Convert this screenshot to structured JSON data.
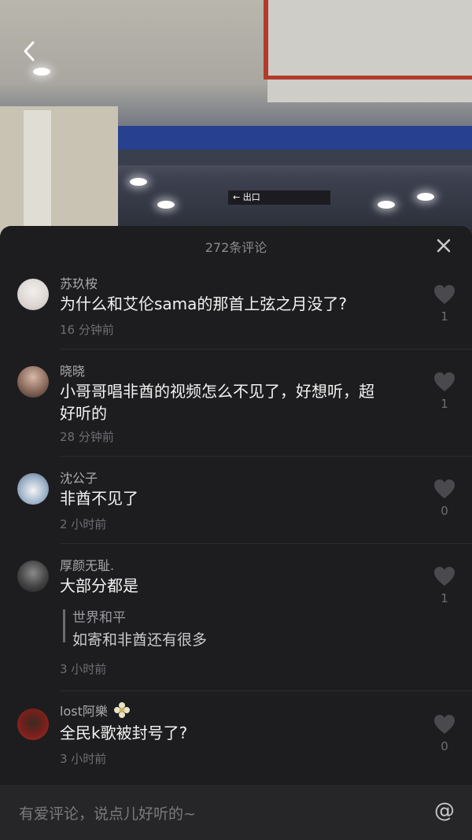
{
  "header": {
    "comment_count_title": "272条评论"
  },
  "video": {
    "exit_sign_text": "出口"
  },
  "comments": [
    {
      "user": "苏玖桉",
      "text": "为什么和艾伦sama的那首上弦之月没了?",
      "time": "16 分钟前",
      "likes": "1"
    },
    {
      "user": "晓晓",
      "text_line1": "小哥哥唱非酋的视频怎么不见了，好想听，超",
      "text_line2": "好听的",
      "time": "28 分钟前",
      "likes": "1"
    },
    {
      "user": "沈公子",
      "text": "非酋不见了",
      "time": "2 小时前",
      "likes": "0"
    },
    {
      "user": "厚颜无耻.",
      "text": "大部分都是",
      "reply_user": "世界和平",
      "reply_text": "如寄和非酋还有很多",
      "time": "3 小时前",
      "likes": "1"
    },
    {
      "user": "lost阿樂",
      "text": "全民k歌被封号了?",
      "time": "3 小时前",
      "likes": "0"
    }
  ],
  "input": {
    "placeholder": "有爱评论，说点儿好听的~",
    "at_symbol": "@"
  },
  "colors": {
    "sheet_bg": "#1d1d1f",
    "like_icon": "#4a4a4e"
  }
}
